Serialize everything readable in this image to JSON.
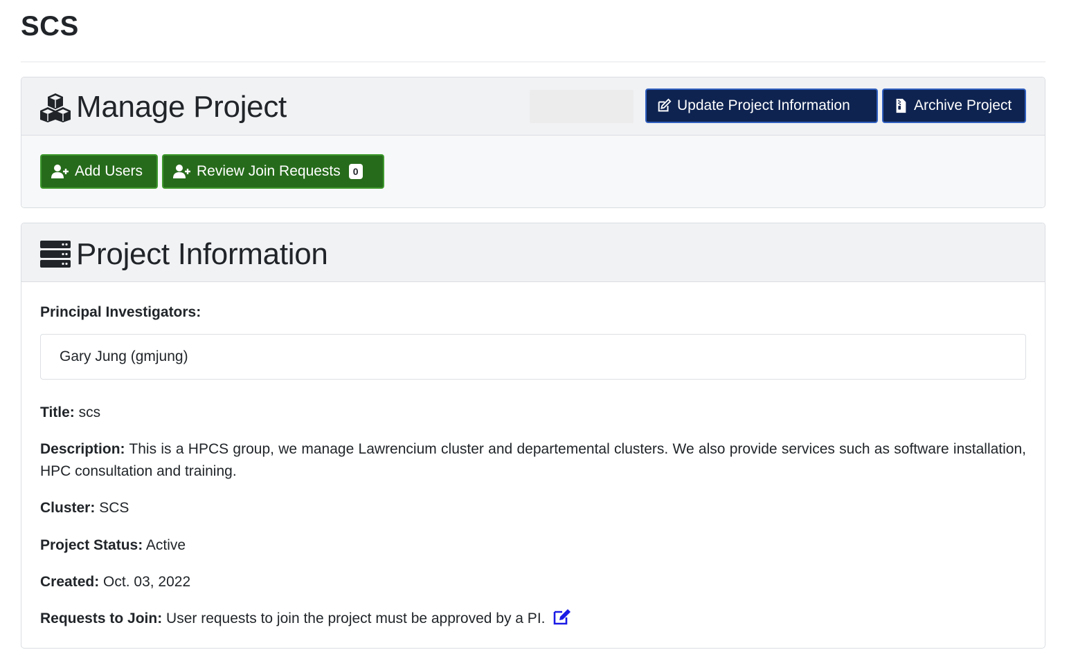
{
  "page": {
    "title": "SCS"
  },
  "manage": {
    "title": "Manage Project",
    "icon": "cubes-icon",
    "update_label": "Update Project Information",
    "archive_label": "Archive Project",
    "add_users_label": "Add Users",
    "review_label": "Review Join Requests",
    "review_count": "0"
  },
  "info": {
    "title": "Project Information",
    "icon": "server-icon",
    "pi_label": "Principal Investigators:",
    "pi_value": "Gary Jung (gmjung)",
    "title_label": "Title:",
    "title_value": "scs",
    "description_label": "Description:",
    "description_value": "This is a HPCS group, we manage Lawrencium cluster and departemental clusters. We also provide services such as software installation, HPC consultation and training.",
    "cluster_label": "Cluster:",
    "cluster_value": "SCS",
    "status_label": "Project Status:",
    "status_value": "Active",
    "created_label": "Created:",
    "created_value": "Oct. 03, 2022",
    "join_label": "Requests to Join:",
    "join_value": "User requests to join the project must be approved by a PI."
  },
  "colors": {
    "dark_button": "#0e2350",
    "green_button": "#266b1b",
    "link_blue": "#1a1ae6"
  }
}
